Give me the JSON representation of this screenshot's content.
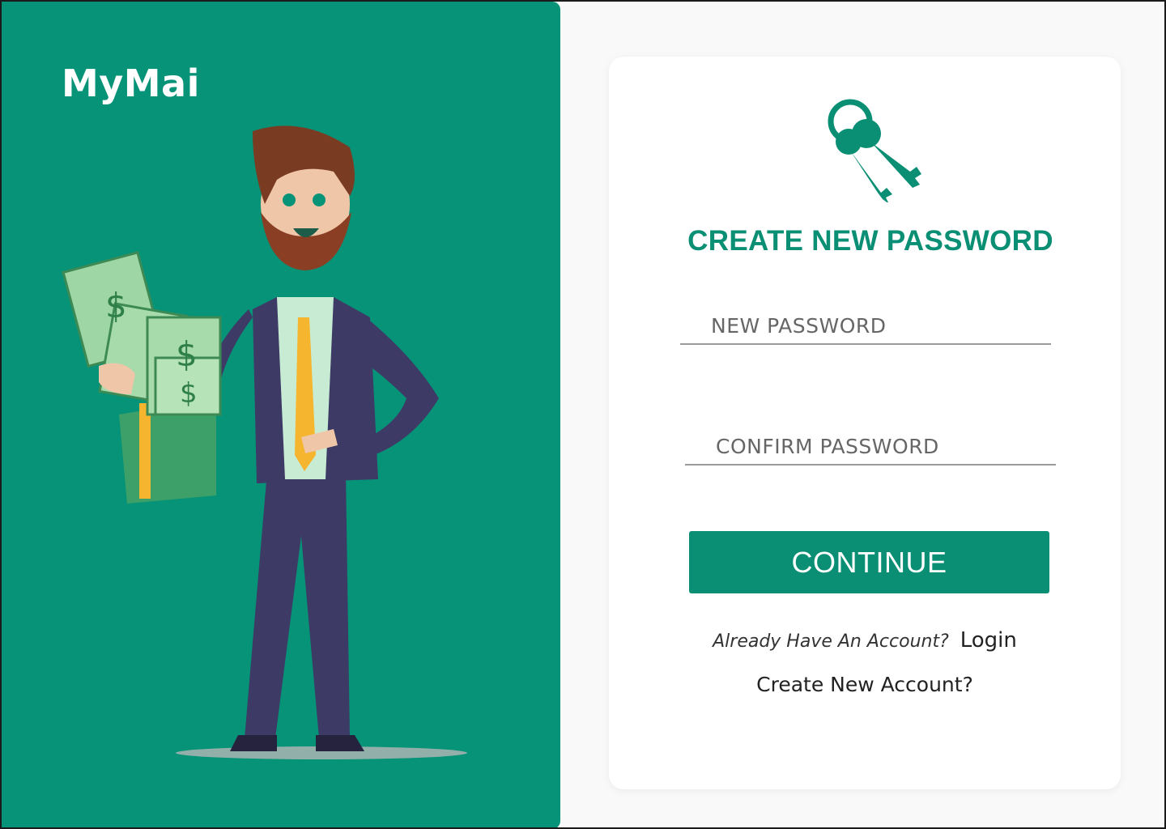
{
  "brand": {
    "name": "MyMai"
  },
  "illustration": {
    "icon": "businessman-with-money-illustration"
  },
  "card": {
    "icon": "keys-icon",
    "title": "CREATE NEW PASSWORD",
    "new_password": {
      "placeholder": "NEW PASSWORD",
      "value": ""
    },
    "confirm_password": {
      "placeholder": "CONFIRM PASSWORD",
      "value": ""
    },
    "continue_label": "CONTINUE",
    "login_prompt": "Already Have An Account?",
    "login_link": "Login",
    "create_account_link": "Create New Account?"
  },
  "colors": {
    "brand_green": "#069378",
    "accent_green": "#0a8f74",
    "page_bg": "#f9f9fa",
    "card_bg": "#ffffff"
  }
}
